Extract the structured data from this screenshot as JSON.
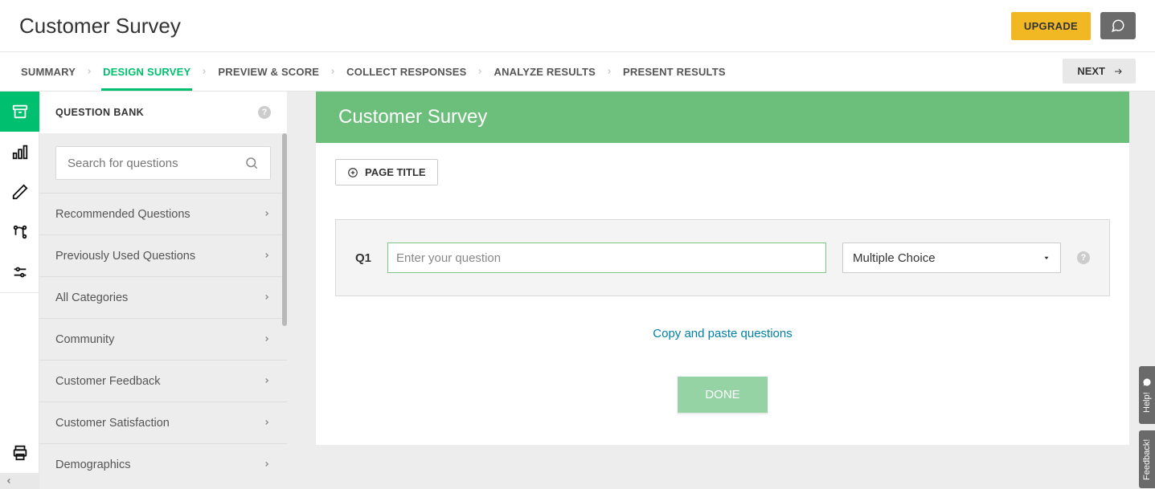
{
  "header": {
    "title": "Customer Survey",
    "upgrade_label": "UPGRADE"
  },
  "nav": {
    "tabs": [
      {
        "label": "SUMMARY",
        "active": false
      },
      {
        "label": "DESIGN SURVEY",
        "active": true
      },
      {
        "label": "PREVIEW & SCORE",
        "active": false
      },
      {
        "label": "COLLECT RESPONSES",
        "active": false
      },
      {
        "label": "ANALYZE RESULTS",
        "active": false
      },
      {
        "label": "PRESENT RESULTS",
        "active": false
      }
    ],
    "next_label": "NEXT"
  },
  "sidebar": {
    "title": "QUESTION BANK",
    "search_placeholder": "Search for questions",
    "categories": [
      {
        "label": "Recommended Questions"
      },
      {
        "label": "Previously Used Questions"
      },
      {
        "label": "All Categories"
      },
      {
        "label": "Community"
      },
      {
        "label": "Customer Feedback"
      },
      {
        "label": "Customer Satisfaction"
      },
      {
        "label": "Demographics"
      }
    ]
  },
  "survey": {
    "banner_title": "Customer Survey",
    "page_title_btn": "PAGE TITLE",
    "question_number": "Q1",
    "question_placeholder": "Enter your question",
    "question_type": "Multiple Choice",
    "copy_paste_link": "Copy and paste questions",
    "done_label": "DONE"
  },
  "float": {
    "help": "Help!",
    "feedback": "Feedback!"
  }
}
